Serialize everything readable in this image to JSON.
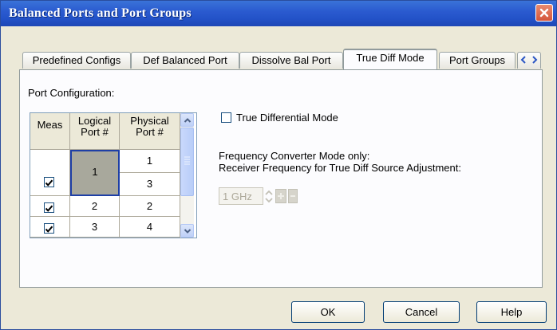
{
  "window": {
    "title": "Balanced Ports and Port Groups"
  },
  "tabs": [
    {
      "label": "Predefined Configs"
    },
    {
      "label": "Def Balanced Port"
    },
    {
      "label": "Dissolve Bal Port"
    },
    {
      "label": "True Diff Mode"
    },
    {
      "label": "Port Groups"
    }
  ],
  "port_config": {
    "label": "Port Configuration:",
    "headers": {
      "meas": "Meas",
      "logical": "Logical Port #",
      "physical": "Physical Port #"
    },
    "rows": [
      {
        "meas": true,
        "logical": "1",
        "physical": [
          "1",
          "3"
        ]
      },
      {
        "meas": true,
        "logical": "2",
        "physical": [
          "2"
        ]
      },
      {
        "meas": true,
        "logical": "3",
        "physical": [
          "4"
        ]
      }
    ]
  },
  "true_diff": {
    "checkbox_label": "True Differential Mode",
    "checked": false
  },
  "freq_converter": {
    "line1": "Frequency Converter Mode only:",
    "line2": "Receiver Frequency for True Diff Source Adjustment:",
    "value": "1 GHz"
  },
  "buttons": {
    "ok": "OK",
    "cancel": "Cancel",
    "help": "Help"
  },
  "colors": {
    "title_bar": "#2352c8",
    "active_tab_accent": "#f3a93b",
    "selected_cell": "#a8a89c"
  }
}
